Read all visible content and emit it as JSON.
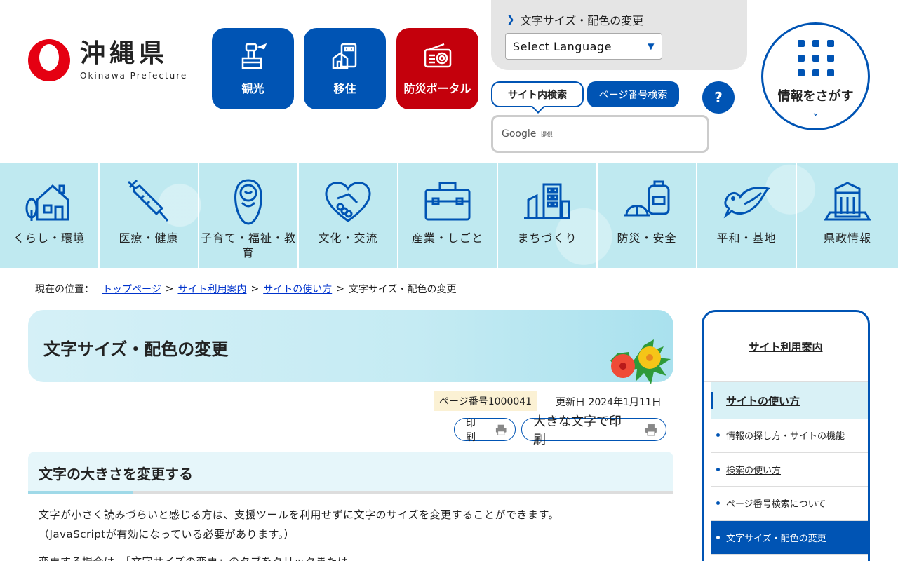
{
  "logo": {
    "name": "沖縄県",
    "english": "Okinawa Prefecture"
  },
  "header_buttons": [
    {
      "label": "観光",
      "icon": "control-tower-icon"
    },
    {
      "label": "移住",
      "icon": "house-building-icon"
    },
    {
      "label": "防災ポータル",
      "icon": "radio-icon"
    }
  ],
  "language": {
    "link": "文字サイズ・配色の変更",
    "select_value": "Select Language"
  },
  "search": {
    "tab_site": "サイト内検索",
    "tab_page": "ページ番号検索",
    "help": "?",
    "google": "Google",
    "google_note": "提供"
  },
  "info_button": {
    "label": "情報をさがす"
  },
  "categories": [
    {
      "label": "くらし・環境",
      "icon": "house-icon"
    },
    {
      "label": "医療・健康",
      "icon": "syringe-icon"
    },
    {
      "label": "子育て・福祉・教育",
      "icon": "baby-icon"
    },
    {
      "label": "文化・交流",
      "icon": "handshake-heart-icon"
    },
    {
      "label": "産業・しごと",
      "icon": "briefcase-icon"
    },
    {
      "label": "まちづくり",
      "icon": "buildings-icon"
    },
    {
      "label": "防災・安全",
      "icon": "helmet-backpack-icon"
    },
    {
      "label": "平和・基地",
      "icon": "dove-icon"
    },
    {
      "label": "県政情報",
      "icon": "government-building-icon"
    }
  ],
  "breadcrumb": {
    "lead": "現在の位置：",
    "items": [
      "トップページ",
      "サイト利用案内",
      "サイトの使い方"
    ],
    "current": "文字サイズ・配色の変更",
    "sep": ">"
  },
  "page": {
    "title": "文字サイズ・配色の変更",
    "page_number": "ページ番号1000041",
    "updated": "更新日 2024年1月11日",
    "print": "印刷",
    "print_large": "大きな文字で印刷",
    "section_title": "文字の大きさを変更する",
    "body_line1": "文字が小さく読みづらいと感じる方は、支援ツールを利用せずに文字のサイズを変更することができます。",
    "body_line2": "（JavaScriptが有効になっている必要があります。）",
    "body_line3": "変更する場合は、「文字サイズの変更」のタブをクリックまたは"
  },
  "sidebar": {
    "heading": "サイト利用案内",
    "sub": "サイトの使い方",
    "items": [
      {
        "label": "情報の探し方・サイトの機能"
      },
      {
        "label": "検索の使い方"
      },
      {
        "label": "ページ番号検索について"
      },
      {
        "label": "文字サイズ・配色の変更"
      }
    ]
  },
  "colors": {
    "brand_blue": "#0054b4",
    "brand_red": "#c4000c",
    "nav_bg": "#bfe9f0"
  }
}
